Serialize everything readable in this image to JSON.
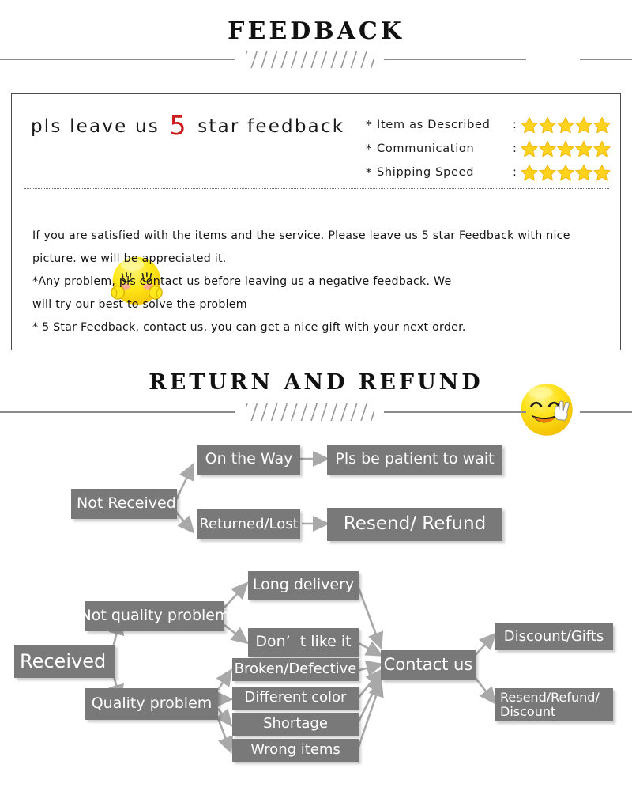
{
  "sections": {
    "feedback_heading": "FEEDBACK",
    "return_heading": "RETURN  AND  REFUND"
  },
  "feedback_panel": {
    "headline_before": "pls leave us",
    "headline_number": "5",
    "headline_after": "star feedback",
    "headline_number_color": "#cc1b1b",
    "ratings": [
      {
        "bullet": "*",
        "label": "Item as Described",
        "colon": ":",
        "stars": 5
      },
      {
        "bullet": "*",
        "label": "Communication",
        "colon": ":",
        "stars": 5
      },
      {
        "bullet": "*",
        "label": "Shipping Speed",
        "colon": ":",
        "stars": 5
      }
    ],
    "star_color": "#FFD21E",
    "body_lines": [
      "If you are satisfied with the items and the service. Please leave us 5 star Feedback with nice",
      "picture. we will be appreciated it.",
      "*Any problem, pls contact us before leaving us a negative feedback. We",
      "will try our best to solve  the problem",
      "* 5 Star Feedback, contact us, you can get a nice gift with your next order.",
      "",
      ""
    ],
    "emoji_shy": "shy-blushing-face-emoji",
    "emoji_peace": "smiling-face-peace-sign-emoji"
  },
  "flowchart": {
    "node_color": "#797979",
    "text_color": "#ffffff",
    "nodes": {
      "not_received": "Not Received",
      "on_the_way": "On the Way",
      "pls_be_patient": "Pls be patient to wait",
      "returned_lost": "Returned/Lost",
      "resend_refund": "Resend/ Refund",
      "received": "Received",
      "not_quality_problem": "Not quality problem",
      "long_delivery": "Long delivery",
      "dont_like_it": "Don’  t like it",
      "quality_problem": "Quality problem",
      "broken_defective": "Broken/Defective",
      "different_color": "Different color",
      "shortage": "Shortage",
      "wrong_items": "Wrong items",
      "contact_us": "Contact us",
      "discount_gifts": "Discount/Gifts",
      "resend_refund_discount": "Resend/Refund/\nDiscount"
    }
  }
}
